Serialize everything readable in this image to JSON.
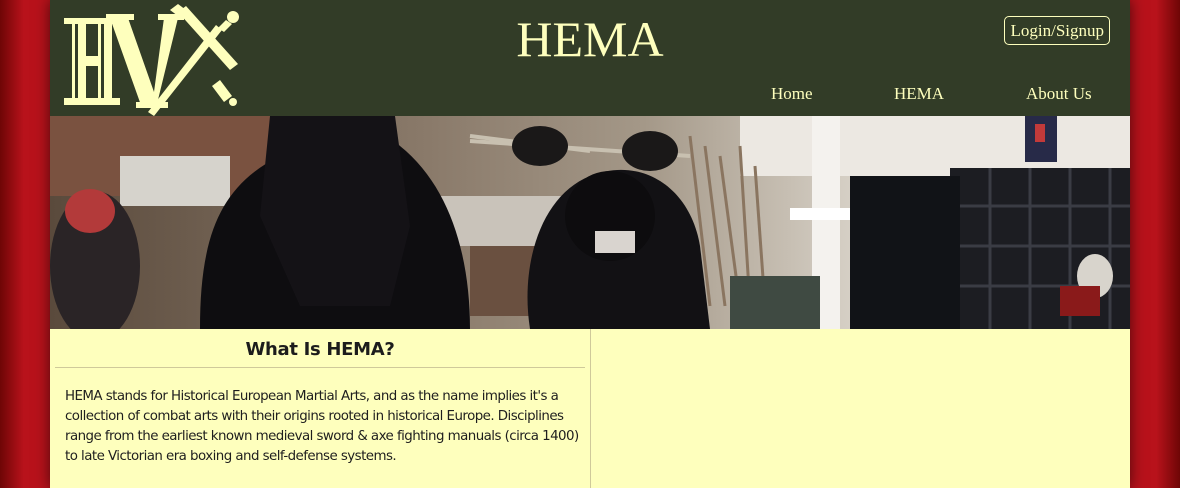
{
  "header": {
    "logo_alt": "HV",
    "title": "HEMA",
    "login_label": "Login/Signup"
  },
  "nav": {
    "items": [
      {
        "label": "Home"
      },
      {
        "label": "HEMA"
      },
      {
        "label": "About Us"
      }
    ]
  },
  "hero": {
    "description": "Photo of HEMA fencers in masks and jackets sparring inside a training hall with sword racks"
  },
  "main": {
    "section_title": "What Is HEMA?",
    "section_body": "HEMA stands for Historical European Martial Arts, and as the name implies it's a collection of combat arts with their origins rooted in historical Europe. Disciplines range from the earliest known medieval sword & axe fighting manuals (circa 1400) to late Victorian era boxing and self-defense systems."
  },
  "colors": {
    "background_red": "#b8121b",
    "header_green": "#323c27",
    "cream": "#feffbd"
  }
}
